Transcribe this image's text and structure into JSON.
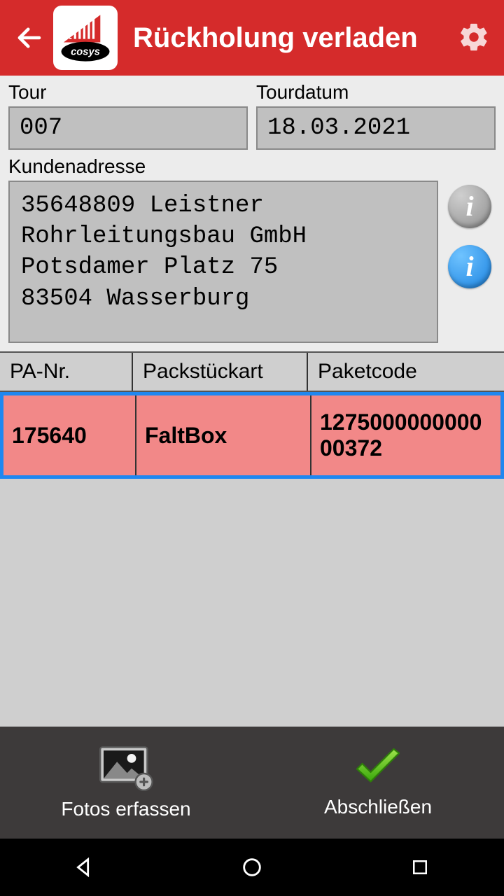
{
  "header": {
    "title": "Rückholung verladen"
  },
  "form": {
    "tour_label": "Tour",
    "tour_value": "007",
    "tourdate_label": "Tourdatum",
    "tourdate_value": "18.03.2021",
    "address_label": "Kundenadresse",
    "address_value": "35648809 Leistner\nRohrleitungsbau GmbH\nPotsdamer Platz 75\n83504 Wasserburg"
  },
  "table": {
    "headers": {
      "pa": "PA-Nr.",
      "art": "Packstückart",
      "code": "Paketcode"
    },
    "rows": [
      {
        "pa": "175640",
        "art": "FaltBox",
        "code": "127500000000000372"
      }
    ]
  },
  "footer": {
    "photos": "Fotos erfassen",
    "finish": "Abschließen"
  }
}
